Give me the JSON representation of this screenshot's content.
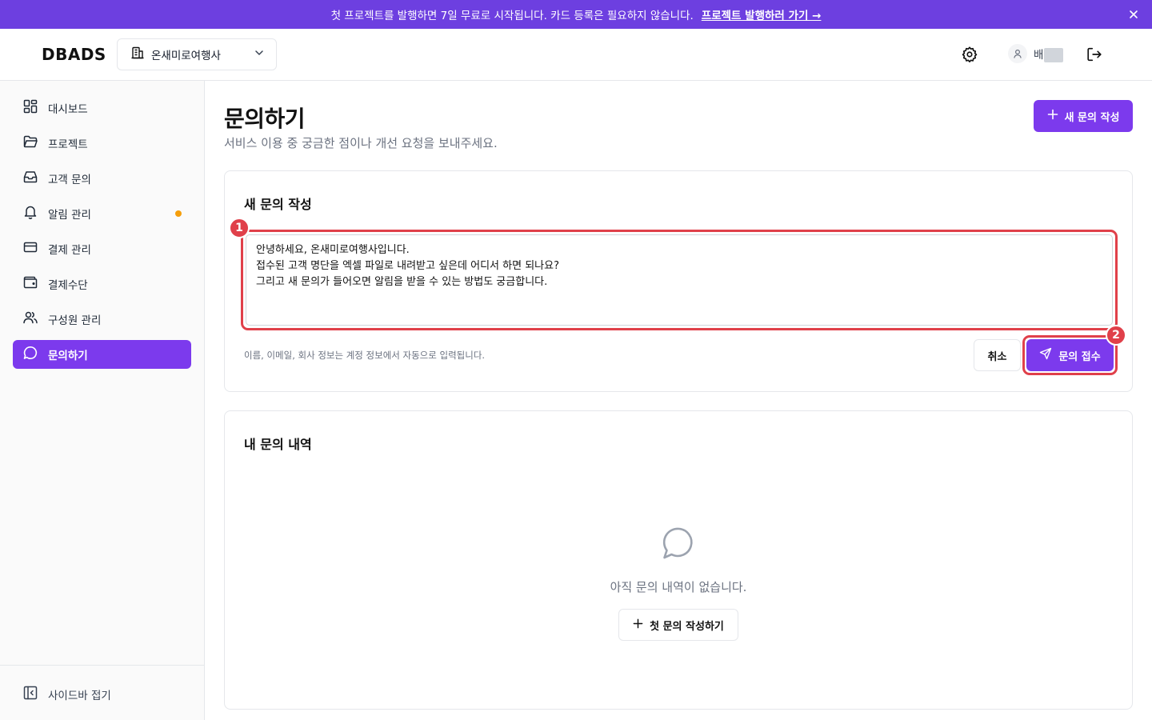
{
  "banner": {
    "message": "첫 프로젝트를 발행하면 7일 무료로 시작됩니다. 카드 등록은 필요하지 않습니다.",
    "link": "프로젝트 발행하러 가기 →",
    "close_icon": "close-icon"
  },
  "header": {
    "logo": "DBADS",
    "org_name": "온새미로여행사",
    "user_name": "배",
    "icons": [
      "building-icon",
      "chevron-down-icon",
      "gear-icon",
      "user-icon",
      "logout-icon"
    ]
  },
  "sidebar": {
    "items": [
      {
        "label": "대시보드",
        "icon": "dashboard-icon"
      },
      {
        "label": "프로젝트",
        "icon": "folder-icon"
      },
      {
        "label": "고객 문의",
        "icon": "inbox-icon"
      },
      {
        "label": "알림 관리",
        "icon": "bell-icon",
        "has_dot": true
      },
      {
        "label": "결제 관리",
        "icon": "credit-card-icon"
      },
      {
        "label": "결제수단",
        "icon": "wallet-icon"
      },
      {
        "label": "구성원 관리",
        "icon": "users-icon"
      },
      {
        "label": "문의하기",
        "icon": "message-icon",
        "active": true
      }
    ],
    "collapse_label": "사이드바 접기"
  },
  "main": {
    "title": "문의하기",
    "subtitle": "서비스 이용 중 궁금한 점이나 개선 요청을 보내주세요.",
    "new_button": "새 문의 작성"
  },
  "compose": {
    "title": "새 문의 작성",
    "message": "안녕하세요, 온새미로여행사입니다.\n접수된 고객 명단을 엑셀 파일로 내려받고 싶은데 어디서 하면 되나요?\n그리고 새 문의가 들어오면 알림을 받을 수 있는 방법도 궁금합니다.",
    "helper": "이름, 이메일, 회사 정보는 계정 정보에서 자동으로 입력됩니다.",
    "cancel": "취소",
    "submit": "문의 접수",
    "badge_1": "1",
    "badge_2": "2"
  },
  "history": {
    "title": "내 문의 내역",
    "empty_text": "아직 문의 내역이 없습니다.",
    "first_button": "첫 문의 작성하기"
  },
  "colors": {
    "accent": "#7c3aed",
    "banner": "#6d3fe0",
    "highlight": "#e0404a",
    "dot": "#f59e0b"
  }
}
